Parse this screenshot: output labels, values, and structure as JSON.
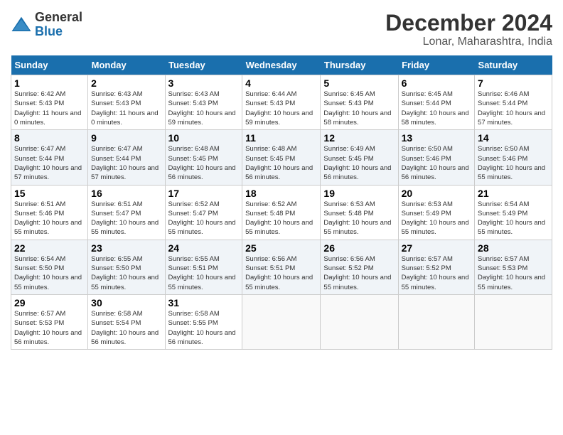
{
  "logo": {
    "general": "General",
    "blue": "Blue"
  },
  "title": "December 2024",
  "location": "Lonar, Maharashtra, India",
  "headers": [
    "Sunday",
    "Monday",
    "Tuesday",
    "Wednesday",
    "Thursday",
    "Friday",
    "Saturday"
  ],
  "weeks": [
    [
      {
        "day": "1",
        "sunrise": "6:42 AM",
        "sunset": "5:43 PM",
        "daylight": "11 hours and 0 minutes."
      },
      {
        "day": "2",
        "sunrise": "6:43 AM",
        "sunset": "5:43 PM",
        "daylight": "11 hours and 0 minutes."
      },
      {
        "day": "3",
        "sunrise": "6:43 AM",
        "sunset": "5:43 PM",
        "daylight": "10 hours and 59 minutes."
      },
      {
        "day": "4",
        "sunrise": "6:44 AM",
        "sunset": "5:43 PM",
        "daylight": "10 hours and 59 minutes."
      },
      {
        "day": "5",
        "sunrise": "6:45 AM",
        "sunset": "5:43 PM",
        "daylight": "10 hours and 58 minutes."
      },
      {
        "day": "6",
        "sunrise": "6:45 AM",
        "sunset": "5:44 PM",
        "daylight": "10 hours and 58 minutes."
      },
      {
        "day": "7",
        "sunrise": "6:46 AM",
        "sunset": "5:44 PM",
        "daylight": "10 hours and 57 minutes."
      }
    ],
    [
      {
        "day": "8",
        "sunrise": "6:47 AM",
        "sunset": "5:44 PM",
        "daylight": "10 hours and 57 minutes."
      },
      {
        "day": "9",
        "sunrise": "6:47 AM",
        "sunset": "5:44 PM",
        "daylight": "10 hours and 57 minutes."
      },
      {
        "day": "10",
        "sunrise": "6:48 AM",
        "sunset": "5:45 PM",
        "daylight": "10 hours and 56 minutes."
      },
      {
        "day": "11",
        "sunrise": "6:48 AM",
        "sunset": "5:45 PM",
        "daylight": "10 hours and 56 minutes."
      },
      {
        "day": "12",
        "sunrise": "6:49 AM",
        "sunset": "5:45 PM",
        "daylight": "10 hours and 56 minutes."
      },
      {
        "day": "13",
        "sunrise": "6:50 AM",
        "sunset": "5:46 PM",
        "daylight": "10 hours and 56 minutes."
      },
      {
        "day": "14",
        "sunrise": "6:50 AM",
        "sunset": "5:46 PM",
        "daylight": "10 hours and 55 minutes."
      }
    ],
    [
      {
        "day": "15",
        "sunrise": "6:51 AM",
        "sunset": "5:46 PM",
        "daylight": "10 hours and 55 minutes."
      },
      {
        "day": "16",
        "sunrise": "6:51 AM",
        "sunset": "5:47 PM",
        "daylight": "10 hours and 55 minutes."
      },
      {
        "day": "17",
        "sunrise": "6:52 AM",
        "sunset": "5:47 PM",
        "daylight": "10 hours and 55 minutes."
      },
      {
        "day": "18",
        "sunrise": "6:52 AM",
        "sunset": "5:48 PM",
        "daylight": "10 hours and 55 minutes."
      },
      {
        "day": "19",
        "sunrise": "6:53 AM",
        "sunset": "5:48 PM",
        "daylight": "10 hours and 55 minutes."
      },
      {
        "day": "20",
        "sunrise": "6:53 AM",
        "sunset": "5:49 PM",
        "daylight": "10 hours and 55 minutes."
      },
      {
        "day": "21",
        "sunrise": "6:54 AM",
        "sunset": "5:49 PM",
        "daylight": "10 hours and 55 minutes."
      }
    ],
    [
      {
        "day": "22",
        "sunrise": "6:54 AM",
        "sunset": "5:50 PM",
        "daylight": "10 hours and 55 minutes."
      },
      {
        "day": "23",
        "sunrise": "6:55 AM",
        "sunset": "5:50 PM",
        "daylight": "10 hours and 55 minutes."
      },
      {
        "day": "24",
        "sunrise": "6:55 AM",
        "sunset": "5:51 PM",
        "daylight": "10 hours and 55 minutes."
      },
      {
        "day": "25",
        "sunrise": "6:56 AM",
        "sunset": "5:51 PM",
        "daylight": "10 hours and 55 minutes."
      },
      {
        "day": "26",
        "sunrise": "6:56 AM",
        "sunset": "5:52 PM",
        "daylight": "10 hours and 55 minutes."
      },
      {
        "day": "27",
        "sunrise": "6:57 AM",
        "sunset": "5:52 PM",
        "daylight": "10 hours and 55 minutes."
      },
      {
        "day": "28",
        "sunrise": "6:57 AM",
        "sunset": "5:53 PM",
        "daylight": "10 hours and 55 minutes."
      }
    ],
    [
      {
        "day": "29",
        "sunrise": "6:57 AM",
        "sunset": "5:53 PM",
        "daylight": "10 hours and 56 minutes."
      },
      {
        "day": "30",
        "sunrise": "6:58 AM",
        "sunset": "5:54 PM",
        "daylight": "10 hours and 56 minutes."
      },
      {
        "day": "31",
        "sunrise": "6:58 AM",
        "sunset": "5:55 PM",
        "daylight": "10 hours and 56 minutes."
      },
      null,
      null,
      null,
      null
    ]
  ]
}
